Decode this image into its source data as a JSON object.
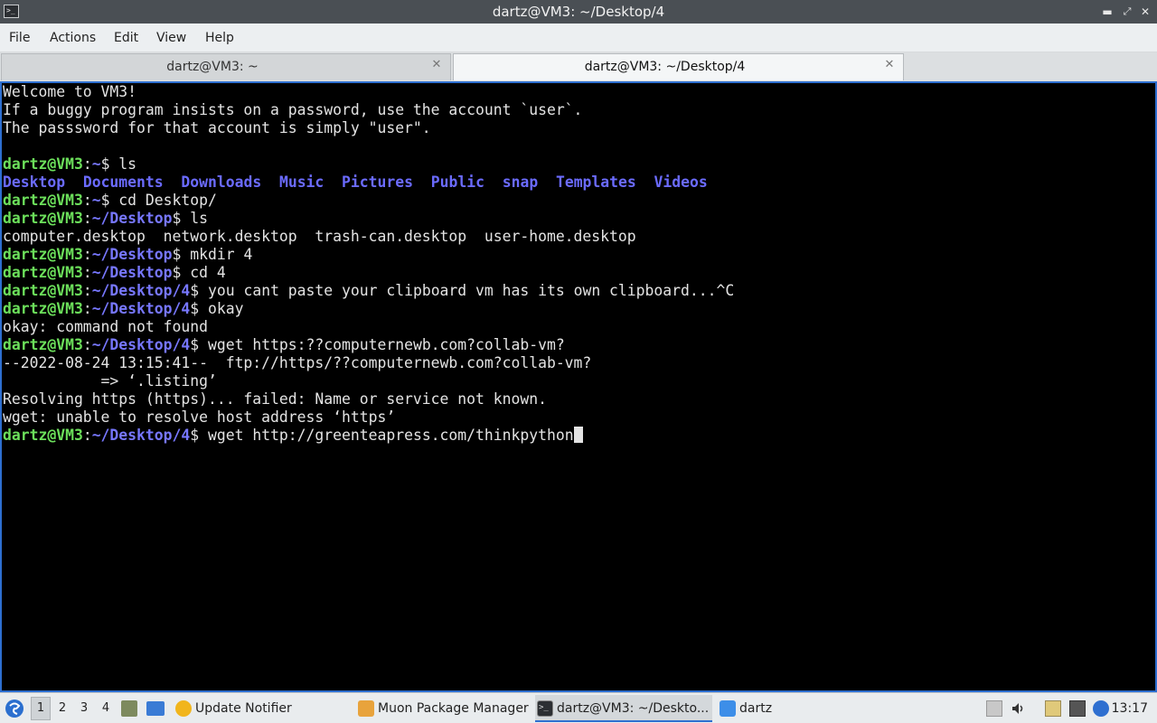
{
  "window": {
    "title": "dartz@VM3: ~/Desktop/4"
  },
  "menu": [
    "File",
    "Actions",
    "Edit",
    "View",
    "Help"
  ],
  "tabs": [
    {
      "label": "dartz@VM3: ~",
      "active": false
    },
    {
      "label": "dartz@VM3: ~/Desktop/4",
      "active": true
    }
  ],
  "terminal": {
    "lines": [
      {
        "type": "text",
        "text": "Welcome to VM3!"
      },
      {
        "type": "text",
        "text": "If a buggy program insists on a password, use the account `user`."
      },
      {
        "type": "text",
        "text": "The passsword for that account is simply \"user\"."
      },
      {
        "type": "text",
        "text": ""
      },
      {
        "type": "prompt",
        "user": "dartz@VM3",
        "path": "~",
        "cmd": " ls"
      },
      {
        "type": "dirs",
        "items": [
          "Desktop",
          "Documents",
          "Downloads",
          "Music",
          "Pictures",
          "Public",
          "snap",
          "Templates",
          "Videos"
        ]
      },
      {
        "type": "prompt",
        "user": "dartz@VM3",
        "path": "~",
        "cmd": " cd Desktop/"
      },
      {
        "type": "prompt",
        "user": "dartz@VM3",
        "path": "~/Desktop",
        "cmd": " ls"
      },
      {
        "type": "text",
        "text": "computer.desktop  network.desktop  trash-can.desktop  user-home.desktop"
      },
      {
        "type": "prompt",
        "user": "dartz@VM3",
        "path": "~/Desktop",
        "cmd": " mkdir 4"
      },
      {
        "type": "prompt",
        "user": "dartz@VM3",
        "path": "~/Desktop",
        "cmd": " cd 4"
      },
      {
        "type": "prompt",
        "user": "dartz@VM3",
        "path": "~/Desktop/4",
        "cmd": " you cant paste your clipboard vm has its own clipboard...^C"
      },
      {
        "type": "prompt",
        "user": "dartz@VM3",
        "path": "~/Desktop/4",
        "cmd": " okay"
      },
      {
        "type": "text",
        "text": "okay: command not found"
      },
      {
        "type": "prompt",
        "user": "dartz@VM3",
        "path": "~/Desktop/4",
        "cmd": " wget https:??computernewb.com?collab-vm?"
      },
      {
        "type": "text",
        "text": "--2022-08-24 13:15:41--  ftp://https/??computernewb.com?collab-vm?"
      },
      {
        "type": "text",
        "text": "           => ‘.listing’"
      },
      {
        "type": "text",
        "text": "Resolving https (https)... failed: Name or service not known."
      },
      {
        "type": "text",
        "text": "wget: unable to resolve host address ‘https’"
      },
      {
        "type": "prompt",
        "user": "dartz@VM3",
        "path": "~/Desktop/4",
        "cmd": " wget http://greenteapress.com/thinkpython",
        "cursor": true
      }
    ]
  },
  "taskbar": {
    "workspaces": [
      "1",
      "2",
      "3",
      "4"
    ],
    "current_workspace": "1",
    "tasks": [
      {
        "label": "Update Notifier",
        "icon": "update-notifier-icon",
        "active": false
      },
      {
        "label": "Muon Package Manager",
        "icon": "package-manager-icon",
        "active": false
      },
      {
        "label": "dartz@VM3: ~/Deskto...",
        "icon": "terminal-icon",
        "active": true
      },
      {
        "label": "dartz",
        "icon": "folder-icon",
        "active": false
      }
    ],
    "clock": "13:17"
  },
  "colors": {
    "prompt_user": "#6ce05b",
    "prompt_path": "#7777ff",
    "dir_listing": "#6b6bff",
    "accent": "#2e6fd0"
  }
}
